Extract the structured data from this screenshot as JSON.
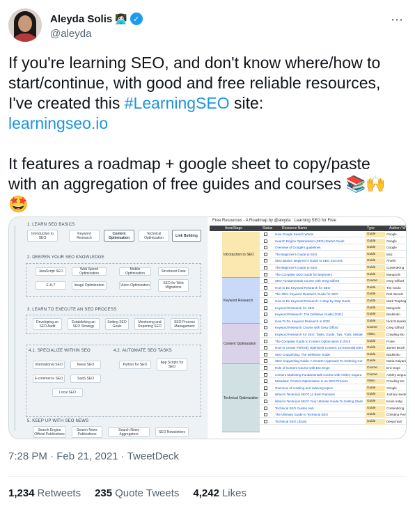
{
  "author": {
    "name": "Aleyda Solis",
    "name_emoji": "👩🏻‍💻",
    "verified_mark": "✓",
    "handle": "@aleyda",
    "more_icon": "⋯"
  },
  "tweet": {
    "line1": "If you're learning SEO, and don't know where/how to",
    "line2": "start/continue, with good and free reliable resources,",
    "line3_pre": "I've created this ",
    "hashtag": "#LearningSEO",
    "line3_post": " site:",
    "link": "learningseo.io",
    "line5": "It features a roadmap + google sheet to copy/paste",
    "line6": "with an aggregation of free guides and courses",
    "emojis_line6": "📚🙌",
    "emoji_line7": "🤩"
  },
  "roadmap": {
    "s1": "1. LEARN SEO BASICS",
    "s1_items": [
      "Introduction to SEO",
      "Keyword Research",
      "Content Optimization",
      "Technical Optimization",
      "Link Building"
    ],
    "s2": "2. DEEPEN YOUR SEO KNOWLEDGE",
    "s2_items": [
      "JavaScript SEO",
      "Web Speed Optimization",
      "Mobile Optimization",
      "Structured Data",
      "E-A-T",
      "Image Optimization",
      "Video Optimization",
      "SEO for Web Migrations"
    ],
    "s3": "3. LEARN TO EXECUTE AN SEO PROCESS",
    "s3_items": [
      "Developing an SEO Audit",
      "Establishing an SEO Strategy",
      "Setting SEO Goals",
      "Monitoring and Reporting SEO",
      "SEO Process Management"
    ],
    "s41": "4.1. SPECIALIZE WITHIN SEO",
    "s41_items": [
      "International SEO",
      "News SEO",
      "E-commerce SEO",
      "SaaS SEO",
      "Local SEO"
    ],
    "s42": "4.2. AUTOMATE SEO TASKS",
    "s42_items": [
      "Python for SEO",
      "App Scripts for SEO"
    ],
    "s5": "5. KEEP UP WITH SEO NEWS",
    "s5_items": [
      "Search Engine Official Publications",
      "Search News Publications",
      "Search News Aggregators",
      "SEO Newsletters"
    ]
  },
  "sheet": {
    "title": "Free Resources - A Roadmap by @aleyda : Learning SEO for Free",
    "headers": {
      "area": "Area/Stage",
      "status": "Status",
      "resource": "Resource Name",
      "type": "Type",
      "author": "Author / W"
    },
    "areas": [
      "Introduction to SEO",
      "Keyword Research",
      "Content Optimization",
      "Technical Optimization"
    ],
    "rows": [
      {
        "res": "How Google Search Works",
        "type": "Guide",
        "author": "Google"
      },
      {
        "res": "Search Engine Optimization (SEO) Starter Guide",
        "type": "Guide",
        "author": "Google"
      },
      {
        "res": "Overview of Google's guidelines",
        "type": "Guide",
        "author": "Google"
      },
      {
        "res": "The Beginner's Guide to SEO",
        "type": "Guide",
        "author": "Moz"
      },
      {
        "res": "SEO Basics: Beginner's Guide to SEO Success",
        "type": "Guide",
        "author": "Ahrefs"
      },
      {
        "res": "The Beginner's Guide to SEO",
        "type": "Guide",
        "author": "ContentKing"
      },
      {
        "res": "The Complete SEO Guide for Beginners",
        "type": "Guide",
        "author": "Mangools"
      },
      {
        "res": "SEO Fundamentals Course with Greg Gifford",
        "type": "Course",
        "author": "Greg Gifford"
      },
      {
        "res": "How to Do Keyword Research for SEO",
        "type": "Guide",
        "author": "Tim Soulo"
      },
      {
        "res": "The 2021 Keyword Research Guide for SEO",
        "type": "Guide",
        "author": "Rob Woods"
      },
      {
        "res": "How to Do Keyword Research: A Step-by-Step Guide",
        "type": "Guide",
        "author": "Mark Traphagen"
      },
      {
        "res": "Keyword Research for SEO",
        "type": "Guide",
        "author": "Mangools"
      },
      {
        "res": "Keyword Research: The Definitive Guide (2021)",
        "type": "Guide",
        "author": "Backlinko"
      },
      {
        "res": "How To Do Keyword Research in 2020",
        "type": "Guide",
        "author": "Nick Eubanks"
      },
      {
        "res": "Keyword Research Course with Greg Gifford",
        "type": "Course",
        "author": "Greg Gifford"
      },
      {
        "res": "Keyword Research for SEO: Tasks, Guide, Tips, Tools, Mistakes and more!",
        "type": "Video",
        "author": "Crawling Mo"
      },
      {
        "res": "The Complete Guide to Content Optimization in 2019",
        "type": "Guide",
        "author": "Frase"
      },
      {
        "res": "How to Create Perfectly Optimized Content: 10 Essential Elements",
        "type": "Guide",
        "author": "James Brock"
      },
      {
        "res": "SEO Copywriting: The Definitive Guide",
        "type": "Guide",
        "author": "Backlinko"
      },
      {
        "res": "SEO Copywriting Guide: A Smarter Approach To Ordering Content",
        "type": "Guide",
        "author": "Maria Kalyani"
      },
      {
        "res": "Role of Content Course with Eric Enge",
        "type": "Course",
        "author": "Eric Enge"
      },
      {
        "res": "Content Marketing Fundamentals Course with Ashley Segura",
        "type": "Course",
        "author": "Ashley Segura"
      },
      {
        "res": "Metadata: Content Optimization in an SEO Process",
        "type": "Video",
        "author": "Crawling Mo"
      },
      {
        "res": "Overview of crawling and indexing topics",
        "type": "Guide",
        "author": "Google"
      },
      {
        "res": "What is Technical SEO? 11 Best Practices",
        "type": "Guide",
        "author": "Joshua Hardwick"
      },
      {
        "res": "What is Technical SEO? Your Ultimate Guide To Getting Started",
        "type": "Guide",
        "author": "Kevin Indig"
      },
      {
        "res": "Technical SEO Guides Hub",
        "type": "Guide",
        "author": "ContentKing"
      },
      {
        "res": "The Ultimate Guide to Technical SEO",
        "type": "Guide",
        "author": "Christina Perricone"
      },
      {
        "res": "Technical SEO Library",
        "type": "Guide",
        "author": "Deepcrawl"
      }
    ]
  },
  "meta": {
    "time": "7:28 PM",
    "sep": "·",
    "date": "Feb 21, 2021",
    "source": "TweetDeck"
  },
  "stats": {
    "retweets_count": "1,234",
    "retweets_label": "Retweets",
    "quotes_count": "235",
    "quotes_label": "Quote Tweets",
    "likes_count": "4,242",
    "likes_label": "Likes"
  },
  "colors": {
    "link": "#1b95e0",
    "verified": "#1d9bf0",
    "intro_bg": "#fbe7b0",
    "kw_bg": "#c9daf8",
    "content_bg": "#d9d2e9",
    "tech_bg": "#d0e0e3"
  }
}
